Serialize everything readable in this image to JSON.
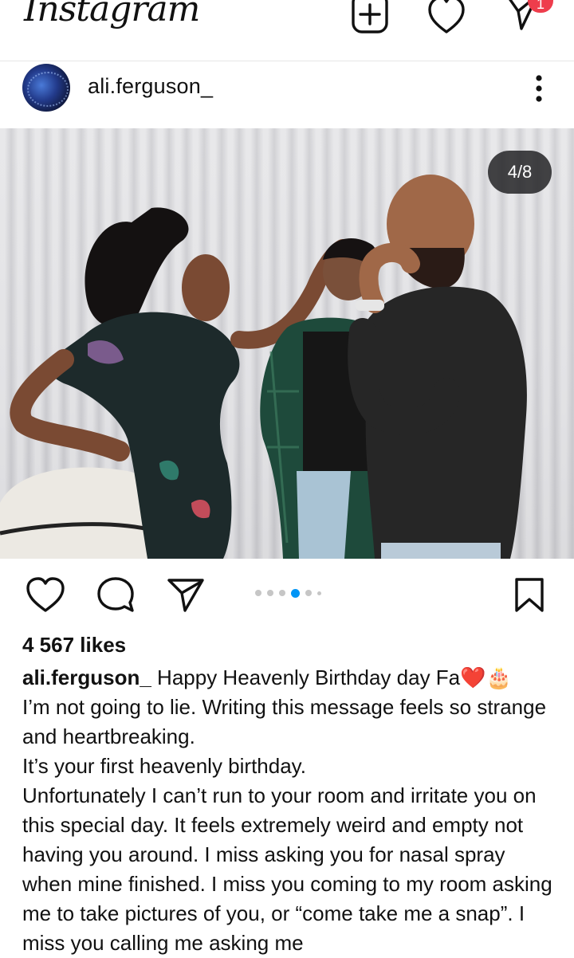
{
  "app": {
    "logo": "Instagram",
    "notification_count": "1"
  },
  "icons": {
    "new_post": "plus-square-icon",
    "activity": "heart-icon",
    "messages": "paper-plane-icon",
    "more": "more-vertical-icon",
    "like": "heart-outline-icon",
    "comment": "comment-icon",
    "share": "paper-plane-icon",
    "save": "bookmark-icon"
  },
  "post": {
    "username": "ali.ferguson_",
    "counter": "4/8",
    "carousel": {
      "total": 6,
      "active_index": 3
    },
    "likes": "4 567 likes",
    "caption_user": "ali.ferguson_",
    "caption_first": " Happy Heavenly Birthday day Fa",
    "caption_heart": "❤️",
    "caption_cake": "🎂",
    "caption_lines": [
      "I’m not going to lie. Writing this message feels so strange and heartbreaking.",
      "It’s your first heavenly birthday.",
      "Unfortunately I can’t run to your room and irritate you on this special day. It feels extremely weird and empty not having you around. I miss asking you for nasal spray when mine finished. I miss you coming to my room asking me to take pictures of you, or “come take me a snap”. I miss you calling me asking me"
    ]
  },
  "colors": {
    "accent": "#0095f6",
    "notification": "#ee3d4c",
    "text": "#111111"
  }
}
